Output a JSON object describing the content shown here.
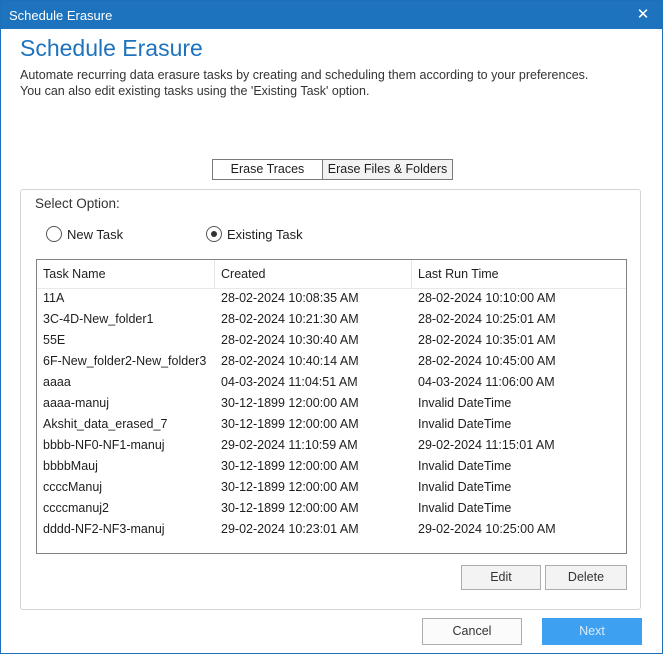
{
  "window": {
    "title": "Schedule Erasure"
  },
  "heading": "Schedule Erasure",
  "description": {
    "line1": "Automate recurring data erasure tasks by creating and scheduling them according to your preferences.",
    "line2": "You can also edit existing tasks using the 'Existing Task' option."
  },
  "tabs": [
    "Erase Traces",
    "Erase Files & Folders"
  ],
  "select_option": {
    "label": "Select Option:",
    "options": [
      "New Task",
      "Existing Task"
    ],
    "selected": "Existing Task"
  },
  "table": {
    "columns": [
      "Task Name",
      "Created",
      "Last Run Time"
    ],
    "rows": [
      [
        "11A",
        "28-02-2024 10:08:35 AM",
        "28-02-2024 10:10:00 AM"
      ],
      [
        "3C-4D-New_folder1",
        "28-02-2024 10:21:30 AM",
        "28-02-2024 10:25:01 AM"
      ],
      [
        "55E",
        "28-02-2024 10:30:40 AM",
        "28-02-2024 10:35:01 AM"
      ],
      [
        "6F-New_folder2-New_folder3",
        "28-02-2024 10:40:14 AM",
        "28-02-2024 10:45:00 AM"
      ],
      [
        "aaaa",
        "04-03-2024 11:04:51 AM",
        "04-03-2024 11:06:00 AM"
      ],
      [
        "aaaa-manuj",
        "30-12-1899 12:00:00 AM",
        "Invalid DateTime"
      ],
      [
        "Akshit_data_erased_7",
        "30-12-1899 12:00:00 AM",
        "Invalid DateTime"
      ],
      [
        "bbbb-NF0-NF1-manuj",
        "29-02-2024 11:10:59 AM",
        "29-02-2024 11:15:01 AM"
      ],
      [
        "bbbbMauj",
        "30-12-1899 12:00:00 AM",
        "Invalid DateTime"
      ],
      [
        "ccccManuj",
        "30-12-1899 12:00:00 AM",
        "Invalid DateTime"
      ],
      [
        "ccccmanuj2",
        "30-12-1899 12:00:00 AM",
        "Invalid DateTime"
      ],
      [
        "dddd-NF2-NF3-manuj",
        "29-02-2024 10:23:01 AM",
        "29-02-2024 10:25:00 AM"
      ]
    ]
  },
  "buttons": {
    "edit": "Edit",
    "delete": "Delete",
    "cancel": "Cancel",
    "next": "Next"
  },
  "icons": {
    "close": "close-icon"
  },
  "colors": {
    "accent": "#1e73be",
    "next_button": "#3ea0f0"
  }
}
